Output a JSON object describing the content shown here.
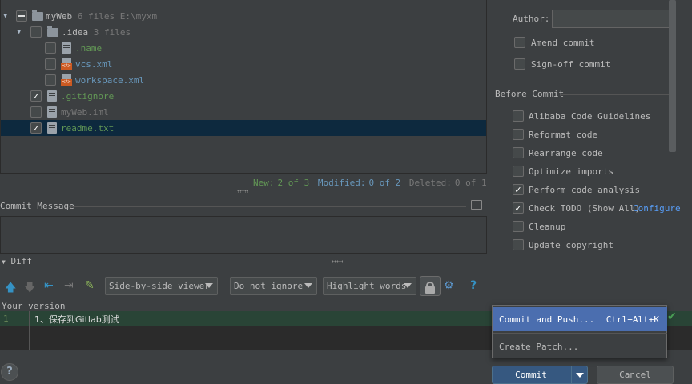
{
  "tree": {
    "rows": [
      {
        "label": "myWeb",
        "meta": "6 files E:\\myxm"
      },
      {
        "label": ".idea",
        "meta": "3 files"
      },
      {
        "label": ".name"
      },
      {
        "label": "vcs.xml"
      },
      {
        "label": "workspace.xml"
      },
      {
        "label": ".gitignore"
      },
      {
        "label": "myWeb.iml"
      },
      {
        "label": "readme.txt"
      }
    ]
  },
  "stats": {
    "new_label": "New:",
    "new_value": "2 of 3",
    "modified_label": "Modified:",
    "modified_value": "0 of 2",
    "deleted_label": "Deleted:",
    "deleted_value": "0 of 1"
  },
  "commit_message": {
    "label": "Commit Message"
  },
  "diff": {
    "label": "Diff",
    "viewer_select": "Side-by-side viewer",
    "ignore_select": "Do not ignore",
    "highlight_select": "Highlight words",
    "your_version": "Your version",
    "line_number": "1",
    "line_text": "1、保存到Gitlab测试"
  },
  "right": {
    "author_label": "Author:",
    "amend_commit": "Amend commit",
    "sign_off_commit": "Sign-off commit",
    "before_commit": "Before Commit",
    "options": [
      {
        "label": "Alibaba Code Guidelines",
        "checked": false
      },
      {
        "label": "Reformat code",
        "checked": false
      },
      {
        "label": "Rearrange code",
        "checked": false
      },
      {
        "label": "Optimize imports",
        "checked": false
      },
      {
        "label": "Perform code analysis",
        "checked": true
      },
      {
        "label": "Check TODO (Show All)",
        "checked": true
      },
      {
        "label": "Cleanup",
        "checked": false
      },
      {
        "label": "Update copyright",
        "checked": false
      }
    ],
    "configure_link": "Configure"
  },
  "popup": {
    "item1": "Commit and Push...",
    "item1_shortcut": "Ctrl+Alt+K",
    "item2": "Create Patch..."
  },
  "buttons": {
    "commit": "Commit",
    "cancel": "Cancel",
    "help": "?"
  },
  "colors": {
    "accent": "#4b6eaf",
    "selection": "#0d293e",
    "added": "#629755",
    "modified": "#6897bb"
  }
}
